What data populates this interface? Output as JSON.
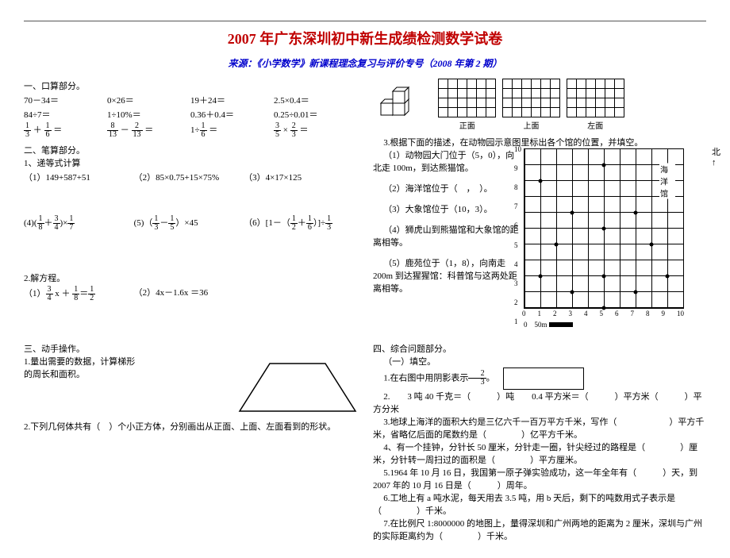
{
  "title": "2007 年广东深圳初中新生成绩检测数学试卷",
  "source": "来源：《小学数学》新课程理念复习与评价专号（2008 年第 2 期）",
  "s1": {
    "head": "一、口算部分。",
    "r1": [
      "70－34＝",
      "0×26＝",
      "19＋24＝",
      "2.5×0.4＝"
    ],
    "r2": [
      "84÷7＝",
      "1÷10%＝",
      "0.36＋0.4＝",
      "0.25÷0.01＝"
    ]
  },
  "s2": {
    "head": "二、笔算部分。",
    "l1": "1、递等式计算",
    "a": "（1）149+587+51",
    "b": "（2）85×0.75+15×75%",
    "c": "（3）4×17×125",
    "l2": "2.解方程。",
    "eq2": "（2）4x－1.6x ＝36"
  },
  "s3": {
    "head": "三、动手操作。",
    "t1": "1.量出需要的数据，计算梯形的周长和面积。",
    "t2": "2.下列几何体共有（　）个小正方体，分别画出从正面、上面、左面看到的形状。",
    "labels": [
      "正面",
      "上面",
      "左面"
    ]
  },
  "q3": {
    "head": "3.根据下面的描述，在动物园示意图里标出各个馆的位置，并填空。",
    "a": "（1）动物园大门位于（5，0），向北走 100m，到达熊猫馆。",
    "b": "（2）海洋馆位于（　，　）。",
    "c": "（3）大象馆位于（10，3）。",
    "d": "（4）狮虎山到熊猫馆和大象馆的距离相等。",
    "e": "（5）鹿苑位于（1，8），向南走 200m 到达猩猩馆：科普馆与这两处距离相等。",
    "marker": "海洋馆",
    "scale": "0　50m",
    "north": "北"
  },
  "s4": {
    "head": "四、综合问题部分。",
    "sub": "（一）填空。",
    "t1a": "1.在右图中用阴影表示",
    "t1b": "。",
    "t2": "2.　　3 吨 40 千克＝（　　　）吨　　0.4 平方米＝（　　　）平方米（　　　）平方分米",
    "t3": "3.地球上海洋的面积大约是三亿六千一百万平方千米，写作（　　　　　　）平方千米，省略亿后面的尾数约是（　　　　）亿平方千米。",
    "t4": "4、有一个挂钟，分针长 50 厘米，分针走一圈，针尖经过的路程是（　　　　）厘米，分针转一周扫过的面积是（　　　　）平方厘米。",
    "t5": "5.1964 年 10 月 16 日，我国第一原子弹实验成功，这一年全年有（　　　）天，到 2007 年的 10 月 16 日是（　　　）周年。",
    "t6": "6.工地上有 a 吨水泥，每天用去 3.5 吨，用 b 天后，剩下的吨数用式子表示是（　　　　）千米。",
    "t7": "7.在比例尺 1:8000000 的地图上，量得深圳和广州两地的距离为 2 厘米，深圳与广州的实际距离约为（　　　　）千米。"
  },
  "chart_data": {
    "type": "scatter",
    "xlim": [
      0,
      10
    ],
    "ylim": [
      0,
      10
    ],
    "xticks": [
      0,
      1,
      2,
      3,
      4,
      5,
      6,
      7,
      8,
      9,
      10
    ],
    "yticks": [
      1,
      2,
      3,
      4,
      5,
      6,
      7,
      8,
      9,
      10
    ],
    "points": [
      {
        "x": 5,
        "y": 0
      },
      {
        "x": 3,
        "y": 1
      },
      {
        "x": 7,
        "y": 1
      },
      {
        "x": 1,
        "y": 2
      },
      {
        "x": 5,
        "y": 2
      },
      {
        "x": 9,
        "y": 2
      },
      {
        "x": 2,
        "y": 4
      },
      {
        "x": 8,
        "y": 4
      },
      {
        "x": 5,
        "y": 5
      },
      {
        "x": 3,
        "y": 6
      },
      {
        "x": 7,
        "y": 6
      },
      {
        "x": 1,
        "y": 8
      },
      {
        "x": 9,
        "y": 8
      },
      {
        "x": 5,
        "y": 9
      }
    ],
    "label": {
      "x": 9,
      "y": 8,
      "text": "海洋馆"
    }
  }
}
